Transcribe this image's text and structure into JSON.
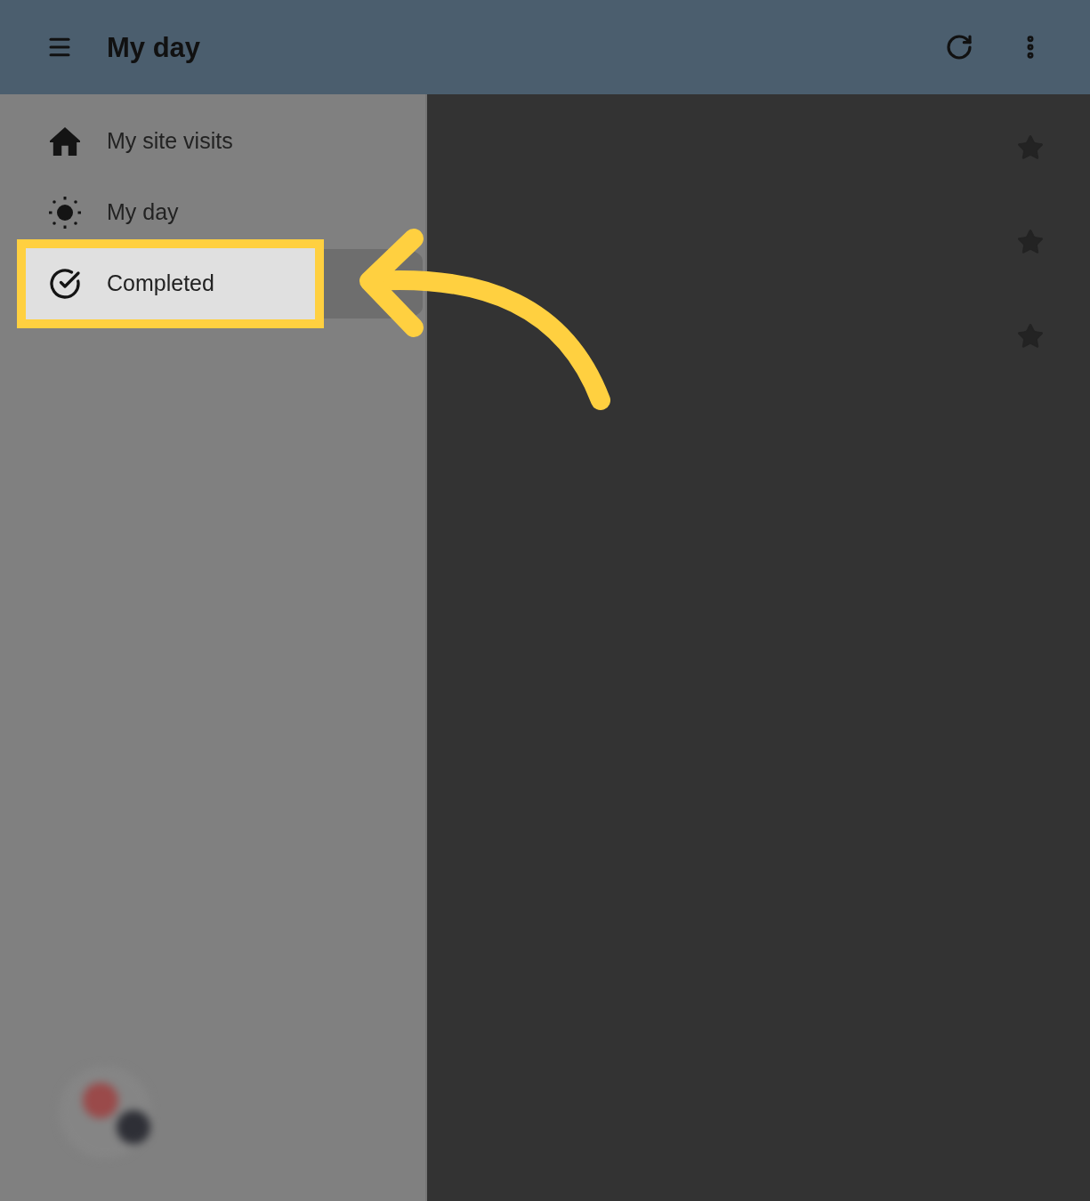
{
  "app_bar": {
    "title": "My day"
  },
  "sidebar": {
    "items": [
      {
        "label": "My site visits",
        "selected": false,
        "highlighted": false
      },
      {
        "label": "My day",
        "selected": false,
        "highlighted": false
      },
      {
        "label": "Completed",
        "selected": true,
        "highlighted": true
      }
    ]
  }
}
